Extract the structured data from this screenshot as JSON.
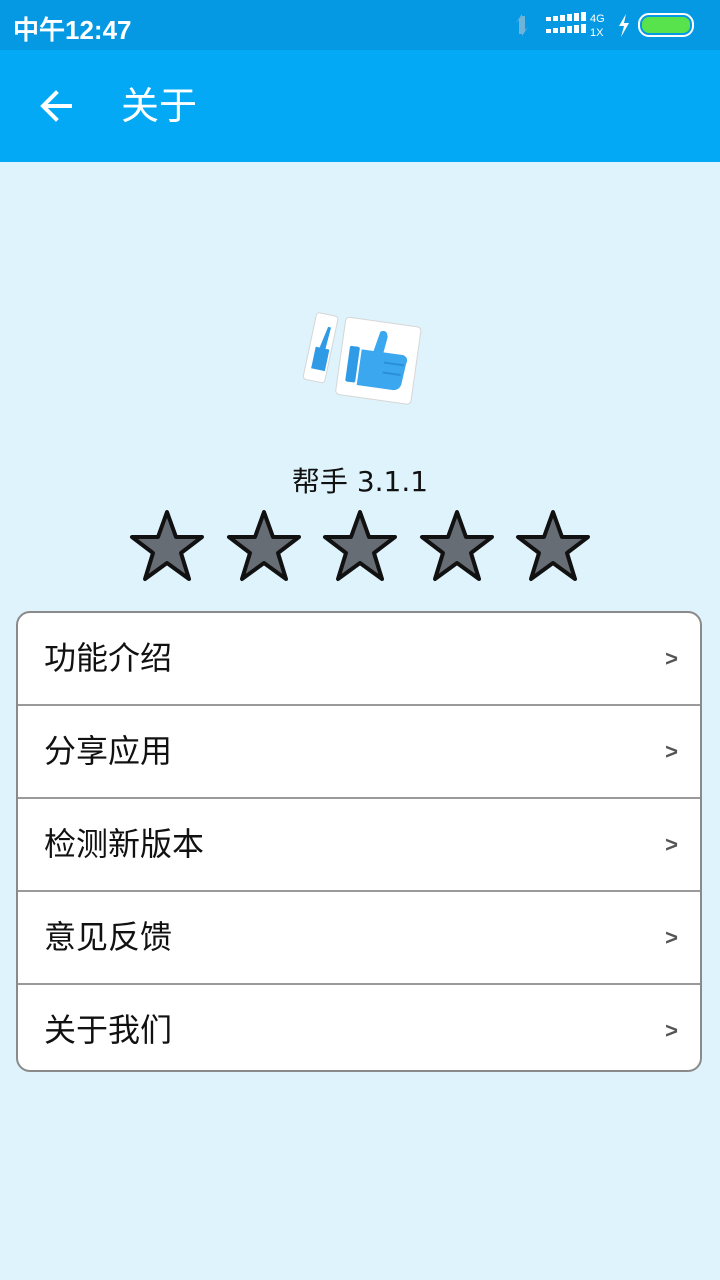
{
  "status_bar": {
    "time": "中午12:47",
    "network_type": "4G",
    "sim_label": "1X",
    "icons": [
      "data-transfer-icon",
      "signal-bars-icon",
      "charging-bolt-icon",
      "battery-icon"
    ],
    "bg_color": "#0599e4"
  },
  "app_bar": {
    "back_icon": "arrow-left-icon",
    "title": "关于",
    "bg_color": "#03a9f4"
  },
  "app_info": {
    "logo_icon": "thumbs-up-icon",
    "name_version": "帮手 3.1.1"
  },
  "rating": {
    "max": 5,
    "icon": "star-icon"
  },
  "menu": {
    "items": [
      {
        "label": "功能介绍",
        "chevron": ">"
      },
      {
        "label": "分享应用",
        "chevron": ">"
      },
      {
        "label": "检测新版本",
        "chevron": ">"
      },
      {
        "label": "意见反馈",
        "chevron": ">"
      },
      {
        "label": "关于我们",
        "chevron": ">"
      }
    ]
  },
  "colors": {
    "page_bg": "#dff3fd",
    "star_fill": "#676d74",
    "star_stroke": "#111111"
  }
}
